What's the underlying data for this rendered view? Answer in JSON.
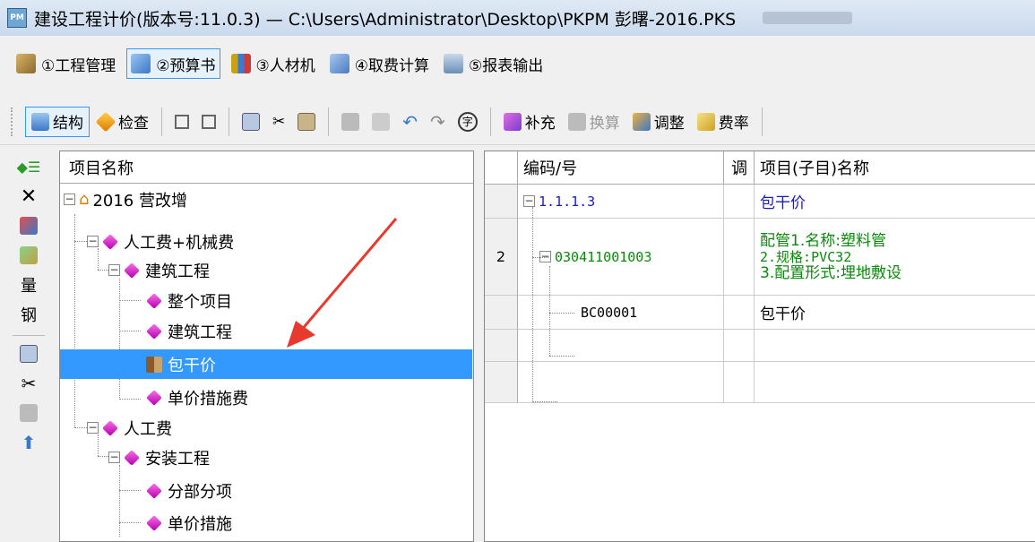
{
  "window": {
    "title": "建设工程计价(版本号:11.0.3) — C:\\Users\\Administrator\\Desktop\\PKPM 彭曙-2016.PKS"
  },
  "menu": [
    {
      "label": "①工程管理",
      "icon": "project-manage-icon",
      "color": "#8a6a2a"
    },
    {
      "label": "②预算书",
      "icon": "budget-book-icon",
      "color": "#3a78c8",
      "active": true
    },
    {
      "label": "③人材机",
      "icon": "resources-icon",
      "color": "#caa015"
    },
    {
      "label": "④取费计算",
      "icon": "fee-calc-icon",
      "color": "#4a7ac0"
    },
    {
      "label": "⑤报表输出",
      "icon": "printer-icon",
      "color": "#6a8fb8"
    }
  ],
  "toolbar": {
    "structure": "结构",
    "check": "检查",
    "supplement": "补充",
    "convert": "换算",
    "adjust": "调整",
    "rate": "费率"
  },
  "left_tools": {
    "quantity": "量",
    "steel": "钢"
  },
  "tree": {
    "header": "项目名称",
    "nodes": [
      {
        "label": "2016 营改增"
      },
      {
        "label": "人工费+机械费"
      },
      {
        "label": "建筑工程"
      },
      {
        "label": "整个项目"
      },
      {
        "label": "建筑工程"
      },
      {
        "label": "包干价"
      },
      {
        "label": "单价措施费"
      },
      {
        "label": "人工费"
      },
      {
        "label": "安装工程"
      },
      {
        "label": "分部分项"
      },
      {
        "label": "单价措施"
      }
    ]
  },
  "grid": {
    "headers": {
      "code": "编码/号",
      "adj": "调",
      "name": "项目(子目)名称"
    },
    "rows": [
      {
        "num": "",
        "code": "1.1.1.3",
        "name": "包干价"
      },
      {
        "num": "2",
        "code": "030411001003",
        "name_lines": [
          "配管1.名称:塑料管",
          "2.规格:PVC32",
          "3.配置形式:埋地敷设"
        ]
      },
      {
        "num": "",
        "code": "BC00001",
        "name": "包干价"
      },
      {
        "num": "",
        "code": "",
        "name": ""
      },
      {
        "num": "",
        "code": "",
        "name": ""
      }
    ]
  },
  "colors": {
    "selection": "#3399ff",
    "section_code": "#1a1acc",
    "item_code": "#0a8a0a",
    "arrow": "#e8392e"
  }
}
